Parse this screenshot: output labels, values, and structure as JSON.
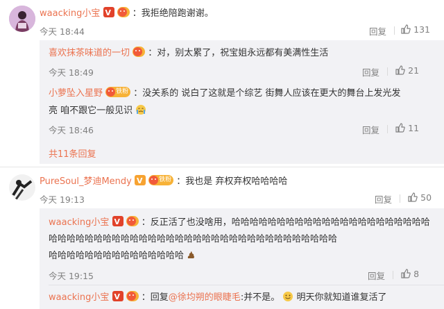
{
  "comments": [
    {
      "user": "waacking小宝",
      "text": "：我拒绝陪跑谢谢。",
      "time": "今天 18:44",
      "reply": "回复",
      "likes": "131"
    },
    {
      "user": "PureSoul_梦迪Mendy",
      "fan_label": "铁粉",
      "text": "：我也是 弃权弃权哈哈哈哈",
      "time": "今天 19:13",
      "reply": "回复",
      "likes": "50"
    }
  ],
  "subreplies": [
    {
      "user": "喜欢抹茶味道的一切",
      "text": "：对，别太累了，祝宝姐永远都有美满性生活",
      "time": "今天 18:49",
      "reply": "回复",
      "likes": "21"
    },
    {
      "user": "小萝坠入星野",
      "fan_label": "铁粉",
      "text_line1": "：没关系的 说白了这就是个综艺  街舞人应该在更大的舞台上发光发",
      "text_line2": "亮  咱不跟它一般见识",
      "time": "今天 18:46",
      "reply": "回复",
      "likes": "11"
    },
    {
      "user": "waacking小宝",
      "text_line1": "：反正活了也没啥用，哈哈哈哈哈哈哈哈哈哈哈哈哈哈哈哈哈哈哈哈哈哈",
      "text_line2": "哈哈哈哈哈哈哈哈哈哈哈哈哈哈哈哈哈哈哈哈哈哈哈哈哈哈哈哈哈哈哈哈",
      "text_line3": "哈哈哈哈哈哈哈哈哈哈哈哈哈哈哈",
      "time": "今天 19:15",
      "reply": "回复",
      "likes": "8"
    },
    {
      "user": "waacking小宝",
      "reply_prefix": "：回复",
      "mention": "@徐均朔的眼睫毛",
      "text_after": ":并不是。",
      "text_tail": "明天你就知道谁复活了"
    }
  ],
  "more_replies": "共11条回复"
}
